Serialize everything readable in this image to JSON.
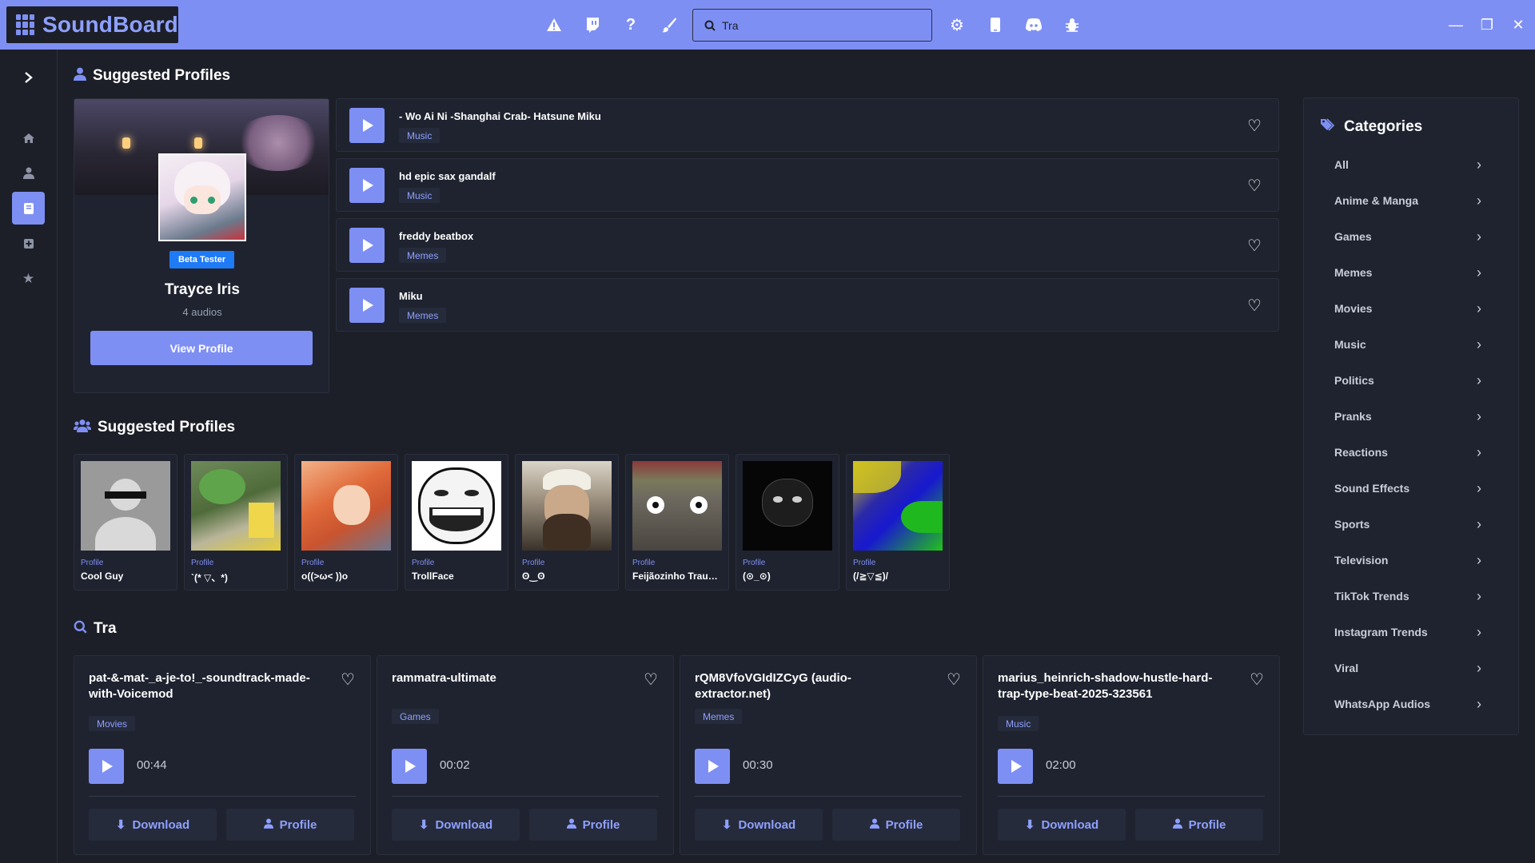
{
  "app": {
    "name": "SoundBoard"
  },
  "toolbar": {
    "icons": [
      "warning-icon",
      "twitch-icon",
      "help-icon",
      "brush-icon",
      "settings-icon",
      "mobile-icon",
      "discord-icon",
      "bug-icon"
    ],
    "search_value": "Tra",
    "search_placeholder": "Search"
  },
  "window": {
    "minimize": "—",
    "restore": "❐",
    "close": "✕"
  },
  "rail": {
    "items": [
      "expand",
      "home",
      "profile",
      "library",
      "add",
      "favorites"
    ],
    "active": "library"
  },
  "suggested_profile": {
    "section_title": "Suggested Profiles",
    "badge": "Beta Tester",
    "name": "Trayce Iris",
    "audio_count": "4 audios",
    "view_button": "View Profile"
  },
  "tracks": [
    {
      "title": "- Wo Ai Ni -Shanghai Crab- Hatsune Miku",
      "tag": "Music"
    },
    {
      "title": "hd epic sax gandalf",
      "tag": "Music"
    },
    {
      "title": "freddy beatbox",
      "tag": "Memes"
    },
    {
      "title": "Miku",
      "tag": "Memes"
    }
  ],
  "profiles_section": {
    "title": "Suggested Profiles",
    "items": [
      {
        "kind": "Profile",
        "name": "Cool Guy"
      },
      {
        "kind": "Profile",
        "name": "`(* ▽、*)"
      },
      {
        "kind": "Profile",
        "name": "o((>ω< ))o"
      },
      {
        "kind": "Profile",
        "name": "TrollFace"
      },
      {
        "kind": "Profile",
        "name": "ʘ‿ʘ"
      },
      {
        "kind": "Profile",
        "name": "Feijãozinho Traum..."
      },
      {
        "kind": "Profile",
        "name": "(⊙_⊙)"
      },
      {
        "kind": "Profile",
        "name": "(/≧▽≦)/"
      }
    ]
  },
  "results": {
    "title": "Tra",
    "items": [
      {
        "title": "pat-&-mat-_a-je-to!_-soundtrack-made-with-Voicemod",
        "tag": "Movies",
        "duration": "00:44",
        "download": "Download",
        "profile": "Profile"
      },
      {
        "title": "rammatra-ultimate",
        "tag": "Games",
        "duration": "00:02",
        "download": "Download",
        "profile": "Profile"
      },
      {
        "title": "rQM8VfoVGIdIZCyG (audio-extractor.net)",
        "tag": "Memes",
        "duration": "00:30",
        "download": "Download",
        "profile": "Profile"
      },
      {
        "title": "marius_heinrich-shadow-hustle-hard-trap-type-beat-2025-323561",
        "tag": "Music",
        "duration": "02:00",
        "download": "Download",
        "profile": "Profile"
      }
    ]
  },
  "categories": {
    "title": "Categories",
    "items": [
      "All",
      "Anime & Manga",
      "Games",
      "Memes",
      "Movies",
      "Music",
      "Politics",
      "Pranks",
      "Reactions",
      "Sound Effects",
      "Sports",
      "Television",
      "TikTok Trends",
      "Instagram Trends",
      "Viral",
      "WhatsApp Audios"
    ]
  },
  "colors": {
    "accent": "#7e8ff4",
    "background": "#1c1f27",
    "card": "#1f2330",
    "badge": "#1f7af5"
  }
}
